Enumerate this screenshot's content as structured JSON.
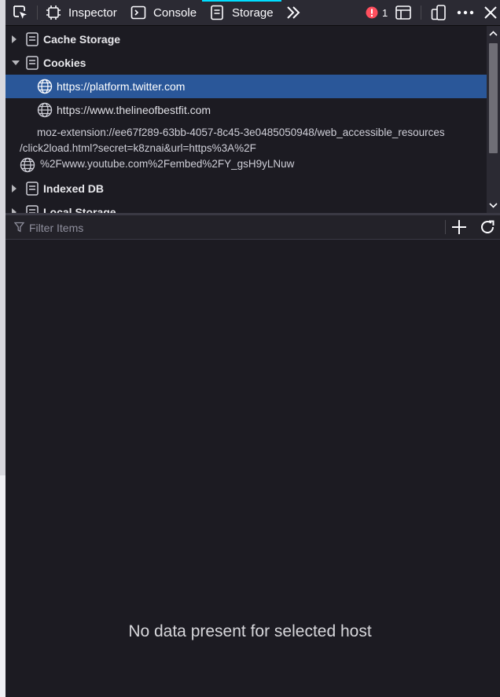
{
  "toolbar": {
    "tabs": [
      {
        "label": "Inspector",
        "icon": "inspector-icon"
      },
      {
        "label": "Console",
        "icon": "console-icon"
      },
      {
        "label": "Storage",
        "icon": "storage-icon",
        "active": true
      }
    ],
    "error_count": "1",
    "accent_color": "#00ddff",
    "error_color": "#ff4f5e"
  },
  "tree": {
    "items": [
      {
        "label": "Cache Storage",
        "expanded": false
      },
      {
        "label": "Cookies",
        "expanded": true,
        "children": [
          {
            "host": "https://platform.twitter.com",
            "selected": true
          },
          {
            "host": "https://www.thelineofbestfit.com"
          },
          {
            "host_lines": [
              "moz-extension://ee67f289-63bb-4057-8c45-3e0485050948/web_accessible_resources",
              "/click2load.html?secret=k8znai&url=https%3A%2F",
              "%2Fwww.youtube.com%2Fembed%2FY_gsH9yLNuw"
            ]
          }
        ]
      },
      {
        "label": "Indexed DB",
        "expanded": false
      },
      {
        "label": "Local Storage",
        "expanded": false
      }
    ],
    "selected_color": "#2a5799"
  },
  "filter": {
    "placeholder": "Filter Items"
  },
  "main": {
    "empty_message": "No data present for selected host"
  }
}
